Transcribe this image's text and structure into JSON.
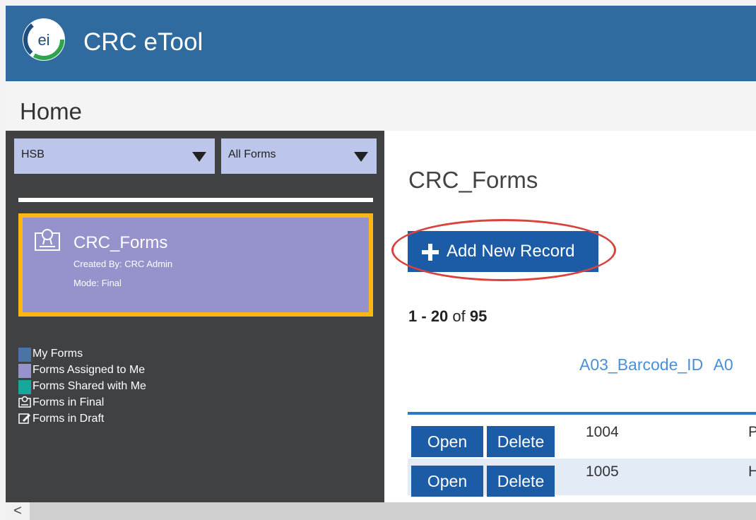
{
  "header": {
    "app_title": "CRC eTool",
    "logo_text": "ei"
  },
  "page": {
    "title": "Home"
  },
  "sidebar": {
    "filters": [
      {
        "value": "HSB"
      },
      {
        "value": "All Forms"
      }
    ],
    "card": {
      "title": "CRC_Forms",
      "created_by": "Created By: CRC Admin",
      "mode": "Mode: Final"
    },
    "legend": [
      {
        "label": "My Forms",
        "color": "#4a74a4"
      },
      {
        "label": "Forms Assigned to Me",
        "color": "#9692cc"
      },
      {
        "label": "Forms Shared with Me",
        "color": "#16a89d"
      },
      {
        "label": "Forms in Final",
        "icon": "certificate-icon"
      },
      {
        "label": "Forms in Draft",
        "icon": "draft-edit-icon"
      }
    ]
  },
  "main": {
    "title": "CRC_Forms",
    "add_button": "Add New Record",
    "paging": {
      "start": "1",
      "sep": " - ",
      "end": "20",
      "of": " of ",
      "total": "95"
    },
    "columns": [
      "A03_Barcode_ID",
      "A0"
    ],
    "row_actions": {
      "open": "Open",
      "delete": "Delete"
    },
    "rows": [
      {
        "id": "1004",
        "next": "Pla"
      },
      {
        "id": "1005",
        "next": "Hi"
      }
    ]
  },
  "scrollbar": {
    "left_arrow": "<"
  },
  "colors": {
    "header": "#2f6b9f",
    "sidebar": "#404142",
    "button": "#1c5ba6",
    "card": "#9692cc",
    "card_border": "#fcb714",
    "link": "#4a90d9",
    "highlight_oval": "#d9423d"
  }
}
